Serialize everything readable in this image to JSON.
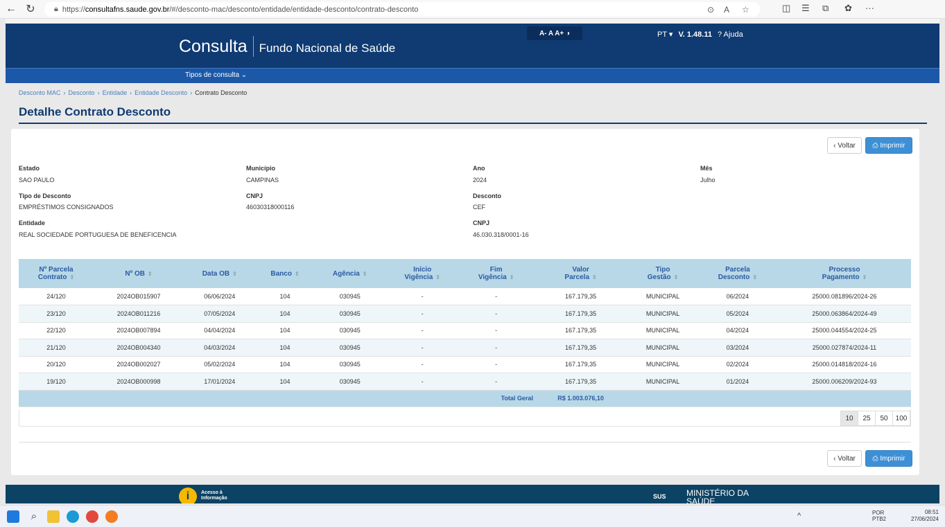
{
  "browser": {
    "url_prefix": "https://",
    "url_host": "consultafns.saude.gov.br",
    "url_path": "/#/desconto-mac/desconto/entidade/entidade-desconto/contrato-desconto"
  },
  "header": {
    "brand_main": "Consulta",
    "brand_sub": "Fundo Nacional de Saúde",
    "font_tools": "A- A A+ ◑",
    "lang": "PT ▾",
    "version": "V. 1.48.11",
    "help": "? Ajuda"
  },
  "nav": {
    "menu": "Tipos de consulta ⌄"
  },
  "breadcrumb": [
    "Desconto MAC",
    "›",
    "Desconto",
    "›",
    "Entidade",
    "›",
    "Entidade Desconto",
    "›",
    "Contrato Desconto"
  ],
  "page_title": "Detalhe Contrato Desconto",
  "buttons": {
    "back": "‹ Voltar",
    "print": "⎙ Imprimir"
  },
  "fields": {
    "estado_label": "Estado",
    "estado": "SAO PAULO",
    "municipio_label": "Município",
    "municipio": "CAMPINAS",
    "ano_label": "Ano",
    "ano": "2024",
    "mes_label": "Mês",
    "mes": "Julho",
    "tipo_label": "Tipo de Desconto",
    "tipo": "EMPRÉSTIMOS CONSIGNADOS",
    "cnpj_label": "CNPJ",
    "cnpj": "46030318000116",
    "desconto_label": "Desconto",
    "desconto": "CEF",
    "entidade_label": "Entidade",
    "entidade": "REAL SOCIEDADE PORTUGUESA DE BENEFICENCIA",
    "cnpj2_label": "CNPJ",
    "cnpj2": "46.030.318/0001-16"
  },
  "table": {
    "headers": [
      [
        "Nº Parcela",
        "Contrato"
      ],
      [
        "Nº OB",
        ""
      ],
      [
        "Data OB",
        ""
      ],
      [
        "Banco",
        ""
      ],
      [
        "Agência",
        ""
      ],
      [
        "Início",
        "Vigência"
      ],
      [
        "Fim",
        "Vigência"
      ],
      [
        "Valor",
        "Parcela"
      ],
      [
        "Tipo",
        "Gestão"
      ],
      [
        "Parcela",
        "Desconto"
      ],
      [
        "Processo",
        "Pagamento"
      ]
    ],
    "rows": [
      [
        "24/120",
        "2024OB015907",
        "06/06/2024",
        "104",
        "030945",
        "-",
        "-",
        "167.179,35",
        "MUNICIPAL",
        "06/2024",
        "25000.081896/2024-26"
      ],
      [
        "23/120",
        "2024OB011216",
        "07/05/2024",
        "104",
        "030945",
        "-",
        "-",
        "167.179,35",
        "MUNICIPAL",
        "05/2024",
        "25000.063864/2024-49"
      ],
      [
        "22/120",
        "2024OB007894",
        "04/04/2024",
        "104",
        "030945",
        "-",
        "-",
        "167.179,35",
        "MUNICIPAL",
        "04/2024",
        "25000.044554/2024-25"
      ],
      [
        "21/120",
        "2024OB004340",
        "04/03/2024",
        "104",
        "030945",
        "-",
        "-",
        "167.179,35",
        "MUNICIPAL",
        "03/2024",
        "25000.027874/2024-11"
      ],
      [
        "20/120",
        "2024OB002027",
        "05/02/2024",
        "104",
        "030945",
        "-",
        "-",
        "167.179,35",
        "MUNICIPAL",
        "02/2024",
        "25000.014818/2024-16"
      ],
      [
        "19/120",
        "2024OB000998",
        "17/01/2024",
        "104",
        "030945",
        "-",
        "-",
        "167.179,35",
        "MUNICIPAL",
        "01/2024",
        "25000.006209/2024-93"
      ]
    ],
    "total_label": "Total Geral",
    "total_value": "R$ 1.003.076,10"
  },
  "pager": [
    "10",
    "25",
    "50",
    "100"
  ],
  "footer": {
    "acesso1": "Acesso à",
    "acesso2": "Informação",
    "sus": "SUS",
    "ms1": "MINISTÉRIO DA",
    "ms2": "SAÚDE"
  },
  "taskbar": {
    "lang": "POR",
    "layout": "PTB2",
    "time": "08:51",
    "date": "27/06/2024"
  },
  "colors": {
    "header": "#0f3a72",
    "nav": "#1c58a8",
    "table_head": "#b8d8e8",
    "button": "#3d8fd6"
  }
}
